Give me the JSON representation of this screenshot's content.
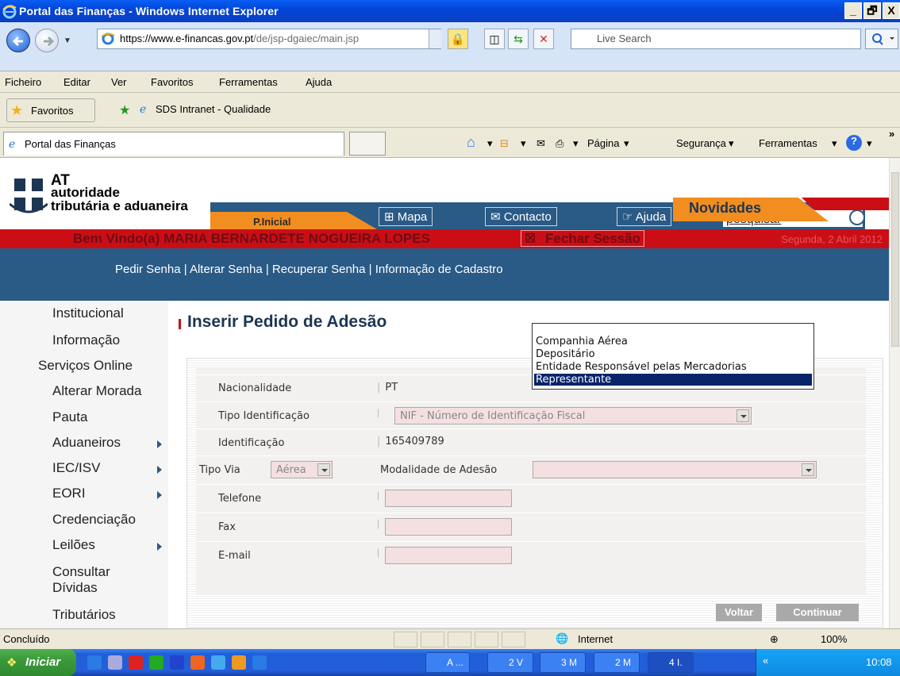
{
  "window": {
    "title": "Portal das Finanças - Windows Internet Explorer",
    "buttons": [
      "_",
      "🗗",
      "X"
    ]
  },
  "address_bar": {
    "url_host": "https://www.e-financas.gov.pt",
    "url_path": "/de/jsp-dgaiec/main.jsp",
    "search_placeholder": "Live Search"
  },
  "menu": [
    "Ficheiro",
    "Editar",
    "Ver",
    "Favoritos",
    "Ferramentas",
    "Ajuda"
  ],
  "favorites_bar": {
    "favorites_label": "Favoritos",
    "link": "SDS Intranet - Qualidade"
  },
  "tab": {
    "label": "Portal das Finanças"
  },
  "command_bar": {
    "page": "Página",
    "security": "Segurança",
    "tools": "Ferramentas"
  },
  "site": {
    "logo": {
      "line1": "AT",
      "line2": "autoridade",
      "line3": "tributária e aduaneira"
    },
    "nav": {
      "home": "P.Inicial",
      "map": "Mapa",
      "contact": "Contacto",
      "help": "Ajuda",
      "search_value": "pesquisar"
    },
    "welcome": "Bem Vindo(a) MARIA BERNARDETE NOGUEIRA LOPES",
    "logout": "Fechar Sessão",
    "date": "Segunda, 2 Abril 2012",
    "sub_links": "Pedir Senha  |  Alterar Senha  |  Recuperar Senha  |  Informação de Cadastro",
    "news": "Novidades"
  },
  "sidebar": {
    "items": [
      {
        "label": "Institucional",
        "arrow": false
      },
      {
        "label": "Informação",
        "arrow": false
      },
      {
        "label": "Serviços Online",
        "arrow": false
      },
      {
        "label": "Alterar Morada",
        "arrow": false
      },
      {
        "label": "Pauta",
        "arrow": false
      },
      {
        "label": "Aduaneiros",
        "arrow": true
      },
      {
        "label": "IEC/ISV",
        "arrow": true
      },
      {
        "label": "EORI",
        "arrow": true
      },
      {
        "label": "Credenciação",
        "arrow": false
      },
      {
        "label": "Leilões",
        "arrow": true
      },
      {
        "label": "Consultar",
        "arrow": false
      },
      {
        "label": "Dívidas",
        "arrow": false
      },
      {
        "label": "Tributários",
        "arrow": false
      }
    ]
  },
  "form": {
    "title": "Inserir Pedido de Adesão",
    "nationality_label": "Nacionalidade",
    "nationality_value": "PT",
    "id_type_label": "Tipo Identificação",
    "id_type_value": "NIF - Número de Identificação Fiscal",
    "id_label": "Identificação",
    "id_value": "165409789",
    "via_label": "Tipo Via",
    "via_value": "Aérea",
    "modality_label": "Modalidade de Adesão",
    "modality_value": "",
    "phone_label": "Telefone",
    "fax_label": "Fax",
    "email_label": "E-mail",
    "modality_options": [
      "Companhia Aérea",
      "Depositário",
      "Entidade Responsável pelas Mercadorias",
      "Representante"
    ],
    "selected_option": "Representante",
    "back_button": "Voltar",
    "continue_button": "Continuar"
  },
  "status_bar": {
    "status": "Concluído",
    "zone": "Internet",
    "zoom": "100%"
  },
  "taskbar": {
    "start": "Iniciar",
    "tasks": [
      "A ...",
      "2 V",
      "3 M",
      "2 M",
      "4 I."
    ],
    "clock": "10:08"
  },
  "colors": {
    "brand_blue": "#2a5a86",
    "brand_red": "#cb0e16",
    "brand_orange": "#f28d1f",
    "selected_option": "#0a246a"
  }
}
